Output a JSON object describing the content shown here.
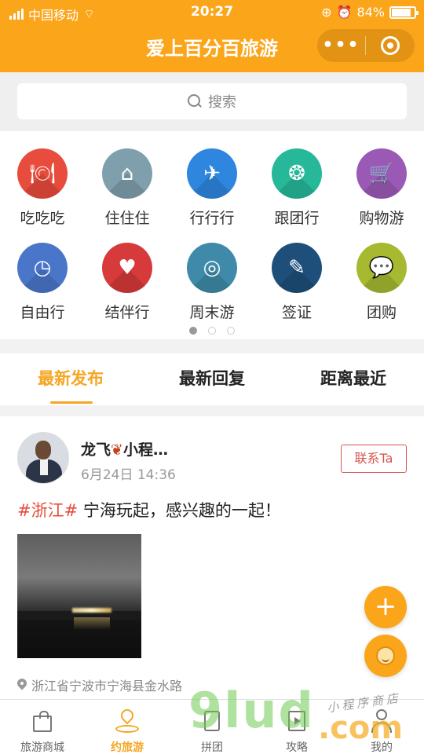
{
  "status_bar": {
    "carrier": "中国移动",
    "time": "20:27",
    "battery": "84%",
    "battery_level": 0.84
  },
  "header": {
    "title": "爱上百分百旅游",
    "more_icon": "more-dots-icon",
    "close_icon": "target-ring-icon"
  },
  "search": {
    "placeholder": "搜索"
  },
  "categories": [
    {
      "label": "吃吃吃",
      "icon": "dining-icon",
      "color": "#e84c3d",
      "glyph": "🍽"
    },
    {
      "label": "住住住",
      "icon": "home-icon",
      "color": "#7f9fad",
      "glyph": "⌂"
    },
    {
      "label": "行行行",
      "icon": "plane-icon",
      "color": "#2e86de",
      "glyph": "✈"
    },
    {
      "label": "跟团行",
      "icon": "group-icon",
      "color": "#26b899",
      "glyph": "❂"
    },
    {
      "label": "购物游",
      "icon": "cart-icon",
      "color": "#9b59b6",
      "glyph": "🛒"
    },
    {
      "label": "自由行",
      "icon": "clock-icon",
      "color": "#4a76c9",
      "glyph": "◷"
    },
    {
      "label": "结伴行",
      "icon": "heart-icon",
      "color": "#d63a3a",
      "glyph": "♥"
    },
    {
      "label": "周末游",
      "icon": "target-icon",
      "color": "#3e8aa8",
      "glyph": "◎"
    },
    {
      "label": "签证",
      "icon": "document-icon",
      "color": "#1e4f7a",
      "glyph": "✎"
    },
    {
      "label": "团购",
      "icon": "chat-icon",
      "color": "#a6b930",
      "glyph": "💬"
    }
  ],
  "pager": {
    "pages": 3,
    "current": 1
  },
  "tabs": [
    {
      "label": "最新发布",
      "active": true
    },
    {
      "label": "最新回复",
      "active": false
    },
    {
      "label": "距离最近",
      "active": false
    }
  ],
  "post": {
    "author": "龙飞",
    "author_suffix": "小程…",
    "time": "6月24日 14:36",
    "contact_label": "联系Ta",
    "tag": "#浙江#",
    "text": " 宁海玩起，感兴趣的一起！",
    "location": "浙江省宁波市宁海县金水路"
  },
  "fabs": {
    "add_label": "+"
  },
  "nav": [
    {
      "label": "旅游商城",
      "icon": "bag-icon",
      "active": false
    },
    {
      "label": "约旅游",
      "icon": "location-pin-icon",
      "active": true
    },
    {
      "label": "拼团",
      "icon": "tag-icon",
      "active": false
    },
    {
      "label": "攻略",
      "icon": "guide-book-icon",
      "active": false
    },
    {
      "label": "我的",
      "icon": "user-icon",
      "active": false
    }
  ],
  "watermark": {
    "main": "9lud",
    "com": ".com",
    "small": "小程序商店"
  },
  "colors": {
    "brand": "#fba51b",
    "accent_red": "#e74c3c"
  }
}
